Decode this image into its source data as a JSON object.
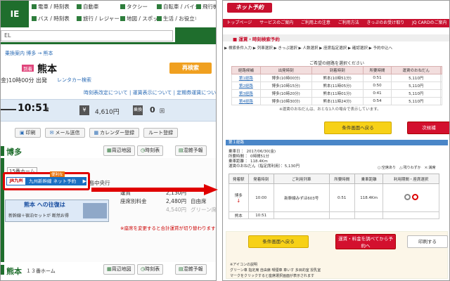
{
  "left": {
    "logo": "IE",
    "nav": [
      "電車 / 時刻表",
      "自動車",
      "タクシー",
      "自転車 / バイク",
      "飛行機",
      "バス / 時刻表",
      "旅行 / レジャー",
      "地図 / スポット",
      "生活 / お役立ち"
    ],
    "search_value": "EL",
    "breadcrumb": "乗換案内 博多 → 熊本",
    "station_label": "到着",
    "station": "熊本",
    "research": "再検索",
    "depart": "金)10時00分 出発",
    "rentacar": "レンタカー検索",
    "links": "時刻表改定について | 運賃表示について | 定期券運賃について",
    "arrive_time": "10:51",
    "arrive_suffix": "着",
    "yen_icon": "¥",
    "fare": "4,610円",
    "transfer_icon": "乗換",
    "transfer_count": "0",
    "transfer_unit": "回",
    "actions": [
      "印刷",
      "メール送信",
      "カレンダー登録",
      "ルート登録"
    ],
    "hakata": "博多",
    "hakata_btns": [
      "周辺地図",
      "時刻表",
      "混雑予報"
    ],
    "platform": "15番ホーム",
    "train": "ＪＲ九州新幹線 みずほ603号 鹿児島中央行",
    "jr_logo": "JR九州",
    "jr_text": "九州新幹線 ネット予約",
    "jr_tag": "便利な",
    "kumamoto_banner_title": "熊本 への往復は",
    "kumamoto_banner_sub": "新幹線＋宿泊セットが 断然お得",
    "fares": [
      {
        "k": "運賃",
        "v": "2,130円",
        "u": ""
      },
      {
        "k": "座席別料金",
        "v": "2,480円",
        "u": "自由席"
      },
      {
        "k": "",
        "v": "4,540円",
        "u": "グリーン席"
      }
    ],
    "notice": "※座席を変更すると合計運賃が切り替わります",
    "kumamoto": "熊本",
    "kumamoto_platform": "１３番ホーム",
    "kumamoto_btns": [
      "周辺地図",
      "時刻表",
      "混雑予報"
    ]
  },
  "right": {
    "logo": "ネット予約",
    "nav": [
      "トップページ",
      "サービスのご案内",
      "ご利用上の注意",
      "ご利用方法",
      "きっぷのお受け取り",
      "JQ CARDのご案内"
    ],
    "title": "■ 運賃・時刻検索予約",
    "steps": "▶ 検索条件入力 ▶ 列車選択 ▶ きっぷ選択 ▶ 人数選択 ▶ 座席指定選択 ▶ 確認選択 ▶ 予約中込へ",
    "candidates_head": "ご希望の経路を選択ください",
    "candidates_cols": [
      "経路候補",
      "出発時刻",
      "到着時刻",
      "所要時間",
      "運賃のおねだん",
      ""
    ],
    "candidates": [
      [
        "第1経路",
        "博多(10時00分)",
        "熊本(10時51分)",
        "0:51",
        "5,110円",
        ""
      ],
      [
        "第2経路",
        "博多(10時15分)",
        "熊本(11時05分)",
        "0:50",
        "5,110円",
        ""
      ],
      [
        "第3経路",
        "博多(10時20分)",
        "熊本(11時01分)",
        "0:41",
        "5,110円",
        ""
      ],
      [
        "第4経路",
        "博多(10時30分)",
        "熊本(11時24分)",
        "0:54",
        "5,110円",
        ""
      ]
    ],
    "cand_note": "※運賃のおねだんは、おとな1人の場合で表示しています。",
    "btn_back": "条件画面へ戻る",
    "btn_next": "次候補",
    "route_label": "第１経路",
    "info": [
      "乗車日 ： 2017/06/30(金)",
      "所要時間 ： 0時間51分",
      "乗車距離 ： 118.4Km",
      "運賃のおねだん（指定席利用）：5,130円"
    ],
    "legend": "○:空席あり　△:残りわずか　×:満席",
    "det_cols": [
      "発着駅",
      "発着時刻",
      "ご利用列車",
      "所要時間",
      "乗車距離",
      "利用期間・座席選択"
    ],
    "det_rows": [
      [
        "博多",
        "10:00",
        "新幹線みずほ603号",
        "0:51",
        "118.4Km"
      ],
      [
        "熊本",
        "10:51",
        "",
        "",
        ""
      ]
    ],
    "btn_back2": "条件画面へ戻る",
    "btn_reserve": "運賃・料金を調べてから予約へ",
    "btn_print": "印刷する",
    "legend_bottom": "※アイコンの説明",
    "legend_items": "グリーン車 指定席 自由席 喫煙車 車いす 多目的室 授乳室",
    "legend_note": "マークをクリックすると座席選択画面が表示されます"
  },
  "colors": {
    "green": "#1f6e2d",
    "red": "#c8102e",
    "yellow": "#f7d117",
    "blue": "#2a6bb5"
  }
}
